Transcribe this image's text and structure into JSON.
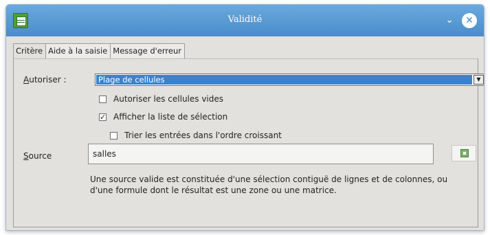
{
  "window": {
    "title": "Validité",
    "minimize_glyph": "⌄",
    "close_glyph": "✕"
  },
  "tabs": [
    {
      "label": "Critère",
      "active": true
    },
    {
      "label": "Aide à la saisie",
      "active": false
    },
    {
      "label": "Message d'erreur",
      "active": false
    }
  ],
  "form": {
    "allow_label_prefix": "A",
    "allow_label_rest": "utoriser :",
    "allow_value": "Plage de cellules",
    "options": [
      {
        "label": "Autoriser les cellules vides",
        "checked": false
      },
      {
        "label": "Afficher la liste de sélection",
        "checked": true
      },
      {
        "label": "Trier les entrées dans l'ordre croissant",
        "checked": false
      }
    ],
    "source_label_prefix": "S",
    "source_label_rest": "ource",
    "source_value": "salles",
    "hint": "Une source valide est constituée d'une sélection contiguë de lignes et de colonnes, ou d'une formule dont le résultat est une zone ou une matrice."
  },
  "colors": {
    "titlebar": "#4a8ccb",
    "selection": "#3a82cf",
    "dialog_bg": "#e3e1de"
  },
  "icons": {
    "app": "spreadsheet-icon",
    "shrink": "shrink-dialog-icon"
  }
}
